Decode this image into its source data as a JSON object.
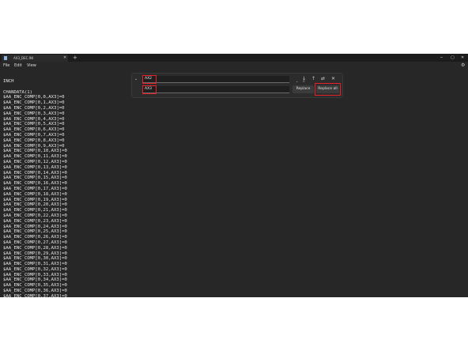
{
  "window": {
    "tab_title": "AX3_DEC.INI"
  },
  "menu": {
    "file": "File",
    "edit": "Edit",
    "view": "View"
  },
  "icons": {
    "app": "notepad-icon",
    "new_tab": "plus-icon",
    "settings": "gear-icon"
  },
  "find_replace": {
    "find_value": "AX2",
    "replace_value": "AX3",
    "replace_label": "Replace",
    "replace_all_label": "Replace all",
    "highlight_color": "#e8202a"
  },
  "editor": {
    "lines": [
      "INCH",
      "",
      "CHANDATA(1)",
      "$AA_ENC_COMP[0,0,AX3]=0",
      "$AA_ENC_COMP[0,1,AX3]=0",
      "$AA_ENC_COMP[0,2,AX3]=0",
      "$AA_ENC_COMP[0,3,AX3]=0",
      "$AA_ENC_COMP[0,4,AX3]=0",
      "$AA_ENC_COMP[0,5,AX3]=0",
      "$AA_ENC_COMP[0,6,AX3]=0",
      "$AA_ENC_COMP[0,7,AX3]=0",
      "$AA_ENC_COMP[0,8,AX3]=0",
      "$AA_ENC_COMP[0,9,AX3]=0",
      "$AA_ENC_COMP[0,10,AX3]=0",
      "$AA_ENC_COMP[0,11,AX3]=0",
      "$AA_ENC_COMP[0,12,AX3]=0",
      "$AA_ENC_COMP[0,13,AX3]=0",
      "$AA_ENC_COMP[0,14,AX3]=0",
      "$AA_ENC_COMP[0,15,AX3]=0",
      "$AA_ENC_COMP[0,16,AX3]=0",
      "$AA_ENC_COMP[0,17,AX3]=0",
      "$AA_ENC_COMP[0,18,AX3]=0",
      "$AA_ENC_COMP[0,19,AX3]=0",
      "$AA_ENC_COMP[0,20,AX3]=0",
      "$AA_ENC_COMP[0,21,AX3]=0",
      "$AA_ENC_COMP[0,22,AX3]=0",
      "$AA_ENC_COMP[0,23,AX3]=0",
      "$AA_ENC_COMP[0,24,AX3]=0",
      "$AA_ENC_COMP[0,25,AX3]=0",
      "$AA_ENC_COMP[0,26,AX3]=0",
      "$AA_ENC_COMP[0,27,AX3]=0",
      "$AA_ENC_COMP[0,28,AX3]=0",
      "$AA_ENC_COMP[0,29,AX3]=0",
      "$AA_ENC_COMP[0,30,AX3]=0",
      "$AA_ENC_COMP[0,31,AX3]=0",
      "$AA_ENC_COMP[0,32,AX3]=0",
      "$AA_ENC_COMP[0,33,AX3]=0",
      "$AA_ENC_COMP[0,34,AX3]=0",
      "$AA_ENC_COMP[0,35,AX3]=0",
      "$AA_ENC_COMP[0,36,AX3]=0",
      "$AA_ENC_COMP[0,37,AX3]=0"
    ]
  }
}
